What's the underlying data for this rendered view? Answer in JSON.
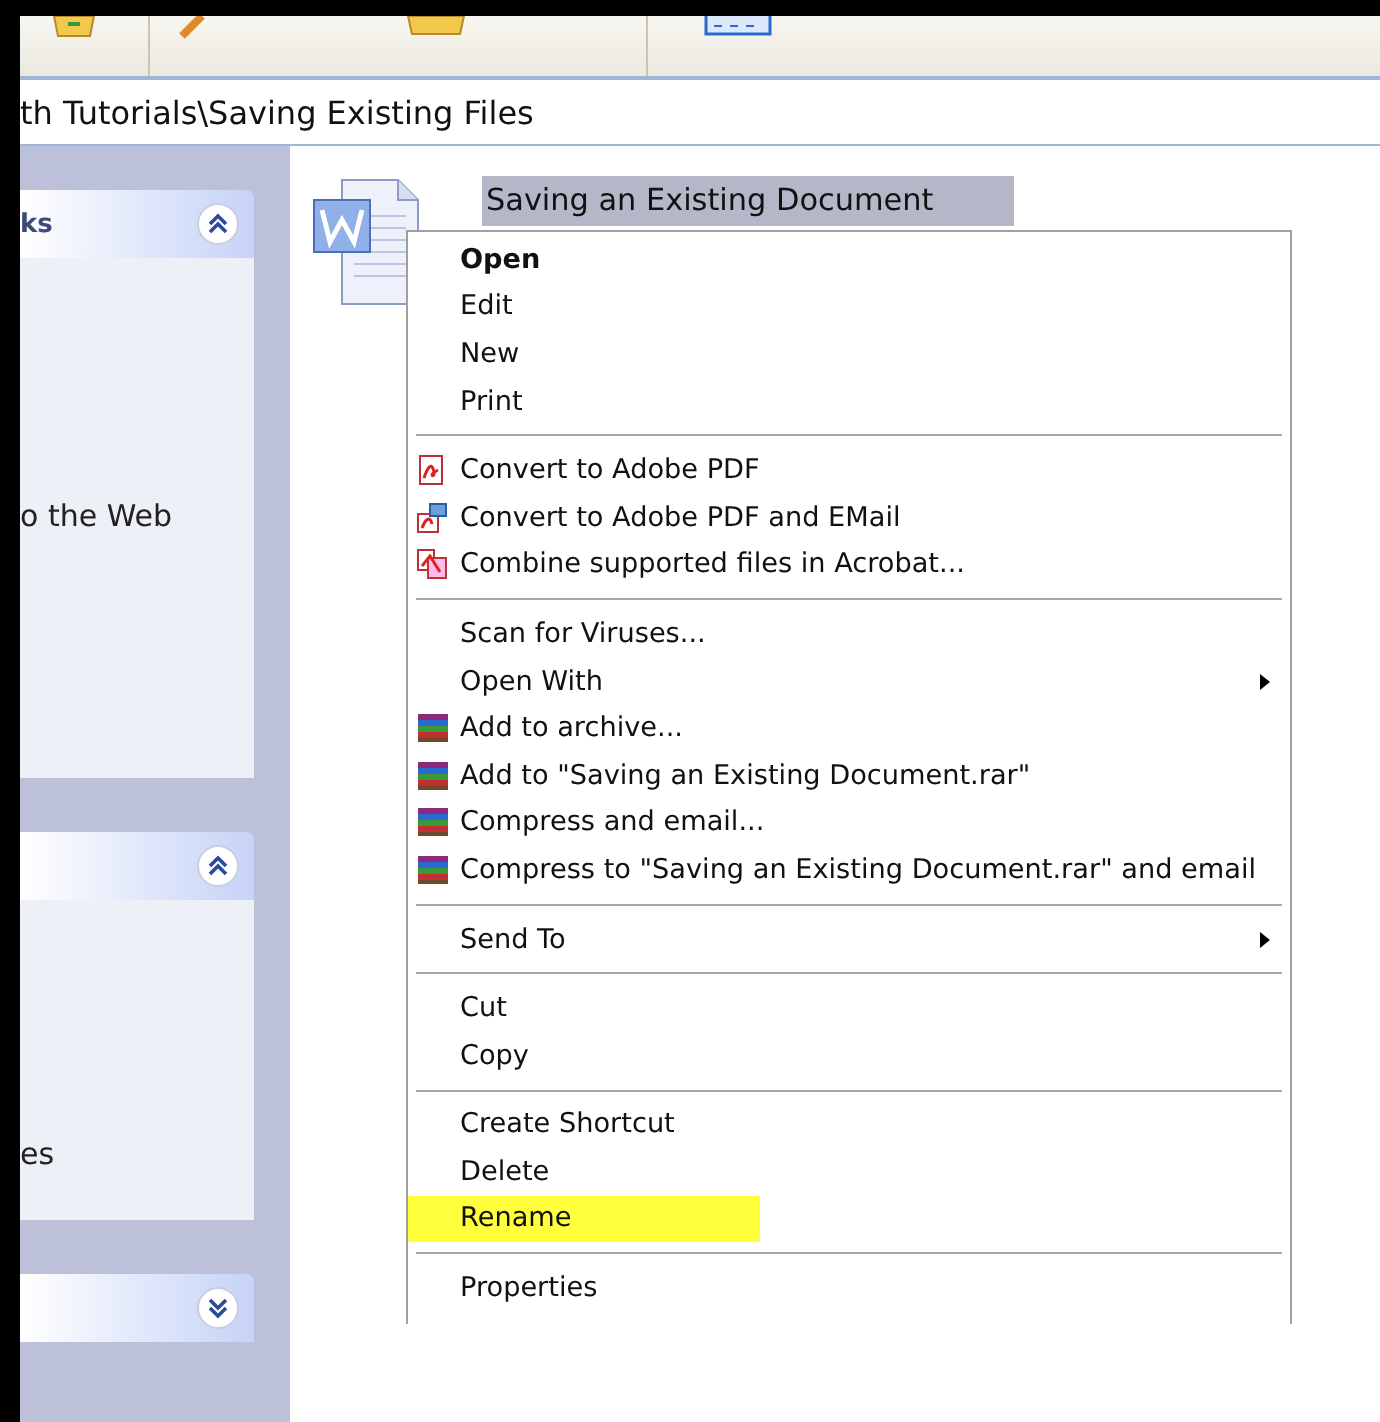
{
  "address_bar": {
    "path": "th Tutorials\\Saving Existing Files"
  },
  "sidebar": {
    "panels": [
      {
        "title": "ks",
        "expanded": true,
        "items": [
          "o the Web"
        ]
      },
      {
        "expanded": true,
        "items": [
          "es"
        ]
      },
      {
        "expanded": false
      }
    ]
  },
  "file": {
    "name": "Saving an Existing Document",
    "selected": true
  },
  "context_menu": {
    "sections": [
      {
        "items": [
          {
            "label": "Open",
            "kind": "plain",
            "default": true,
            "submenu": false,
            "highlighted": false
          },
          {
            "label": "Edit",
            "kind": "plain",
            "default": false,
            "submenu": false,
            "highlighted": false
          },
          {
            "label": "New",
            "kind": "plain",
            "default": false,
            "submenu": false,
            "highlighted": false
          },
          {
            "label": "Print",
            "kind": "plain",
            "default": false,
            "submenu": false,
            "highlighted": false
          }
        ]
      },
      {
        "items": [
          {
            "label": "Convert to Adobe PDF",
            "kind": "pdf",
            "default": false,
            "submenu": false,
            "highlighted": false
          },
          {
            "label": "Convert to Adobe PDF and EMail",
            "kind": "pdf-mail",
            "default": false,
            "submenu": false,
            "highlighted": false
          },
          {
            "label": "Combine supported files in Acrobat...",
            "kind": "pdf-combine",
            "default": false,
            "submenu": false,
            "highlighted": false
          }
        ]
      },
      {
        "items": [
          {
            "label": "Scan for Viruses...",
            "kind": "plain",
            "default": false,
            "submenu": false,
            "highlighted": false
          },
          {
            "label": "Open With",
            "kind": "plain",
            "default": false,
            "submenu": true,
            "highlighted": false
          },
          {
            "label": "Add to archive...",
            "kind": "rar",
            "default": false,
            "submenu": false,
            "highlighted": false
          },
          {
            "label": "Add to \"Saving an Existing Document.rar\"",
            "kind": "rar",
            "default": false,
            "submenu": false,
            "highlighted": false
          },
          {
            "label": "Compress and email...",
            "kind": "rar",
            "default": false,
            "submenu": false,
            "highlighted": false
          },
          {
            "label": "Compress to \"Saving an Existing Document.rar\" and email",
            "kind": "rar",
            "default": false,
            "submenu": false,
            "highlighted": false
          }
        ]
      },
      {
        "items": [
          {
            "label": "Send To",
            "kind": "plain",
            "default": false,
            "submenu": true,
            "highlighted": false
          }
        ]
      },
      {
        "items": [
          {
            "label": "Cut",
            "kind": "plain",
            "default": false,
            "submenu": false,
            "highlighted": false
          },
          {
            "label": "Copy",
            "kind": "plain",
            "default": false,
            "submenu": false,
            "highlighted": false
          }
        ]
      },
      {
        "items": [
          {
            "label": "Create Shortcut",
            "kind": "plain",
            "default": false,
            "submenu": false,
            "highlighted": false
          },
          {
            "label": "Delete",
            "kind": "plain",
            "default": false,
            "submenu": false,
            "highlighted": false
          },
          {
            "label": "Rename",
            "kind": "plain",
            "default": false,
            "submenu": false,
            "highlighted": true
          }
        ]
      },
      {
        "items": [
          {
            "label": "Properties",
            "kind": "plain",
            "default": false,
            "submenu": false,
            "highlighted": false
          }
        ]
      }
    ]
  }
}
